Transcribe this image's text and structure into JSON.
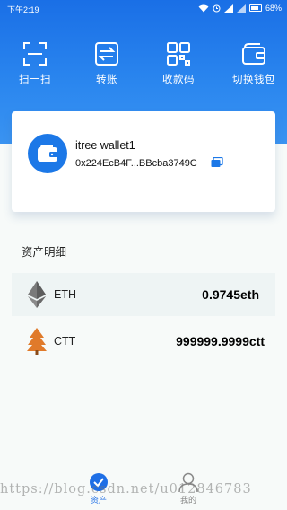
{
  "status_bar": {
    "time": "下午2:19",
    "battery": "68%"
  },
  "actions": [
    {
      "label": "扫一扫",
      "icon": "scan-icon"
    },
    {
      "label": "转账",
      "icon": "transfer-icon"
    },
    {
      "label": "收款码",
      "icon": "qr-code-icon"
    },
    {
      "label": "切换钱包",
      "icon": "switch-wallet-icon"
    }
  ],
  "wallet": {
    "name": "itree wallet1",
    "address": "0x224EcB4F...BBcba3749C",
    "icon": "wallet-icon"
  },
  "assets": {
    "title": "资产明细",
    "items": [
      {
        "symbol": "ETH",
        "balance": "0.9745eth",
        "icon": "eth-icon"
      },
      {
        "symbol": "CTT",
        "balance": "999999.9999ctt",
        "icon": "ctt-tree-icon"
      }
    ]
  },
  "tabbar": {
    "items": [
      {
        "label": "资产",
        "active": true
      },
      {
        "label": "我的",
        "active": false
      }
    ]
  },
  "watermark": "https://blog.csdn.net/u012846783",
  "colors": {
    "accent": "#1c78e7",
    "header_top": "#1a6fe6",
    "header_bottom": "#3a93f1",
    "active_tab": "#1f6fe6"
  }
}
